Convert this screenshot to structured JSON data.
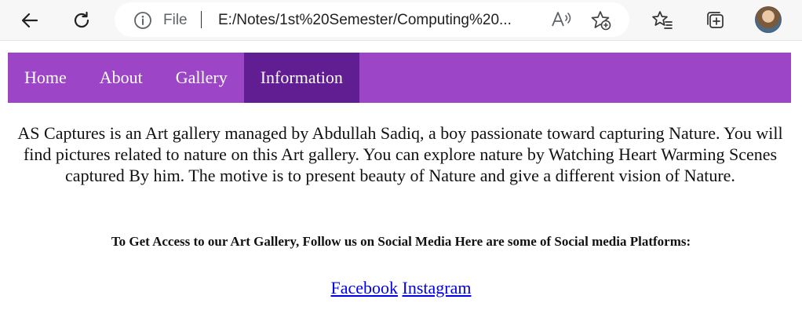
{
  "browser": {
    "omnibox": {
      "scheme_label": "File",
      "url": "E:/Notes/1st%20Semester/Computing%20..."
    },
    "icons": {
      "back": "arrow-left-icon",
      "reload": "reload-icon",
      "info": "info-icon",
      "read_aloud": "read-aloud-icon",
      "add_favorite": "star-add-icon",
      "favorites": "favorites-list-icon",
      "collections": "collections-icon",
      "profile": "profile-avatar"
    }
  },
  "nav": {
    "items": [
      {
        "label": "Home"
      },
      {
        "label": "About"
      },
      {
        "label": "Gallery"
      },
      {
        "label": "Information"
      }
    ],
    "active_index": 3,
    "bar_color": "#9c45c7",
    "active_color": "#611d92"
  },
  "content": {
    "intro": "AS Captures is an Art gallery managed by Abdullah Sadiq, a boy passionate toward capturing Nature. You will find pictures related to nature on this Art gallery. You can explore nature by Watching Heart Warming Scenes captured By him. The motive is to present beauty of Nature and give a different vision of Nature.",
    "cta": "To Get Access to our Art Gallery, Follow us on Social Media Here are some of Social media Platforms:",
    "links": [
      {
        "label": "Facebook"
      },
      {
        "label": "Instagram"
      }
    ]
  }
}
